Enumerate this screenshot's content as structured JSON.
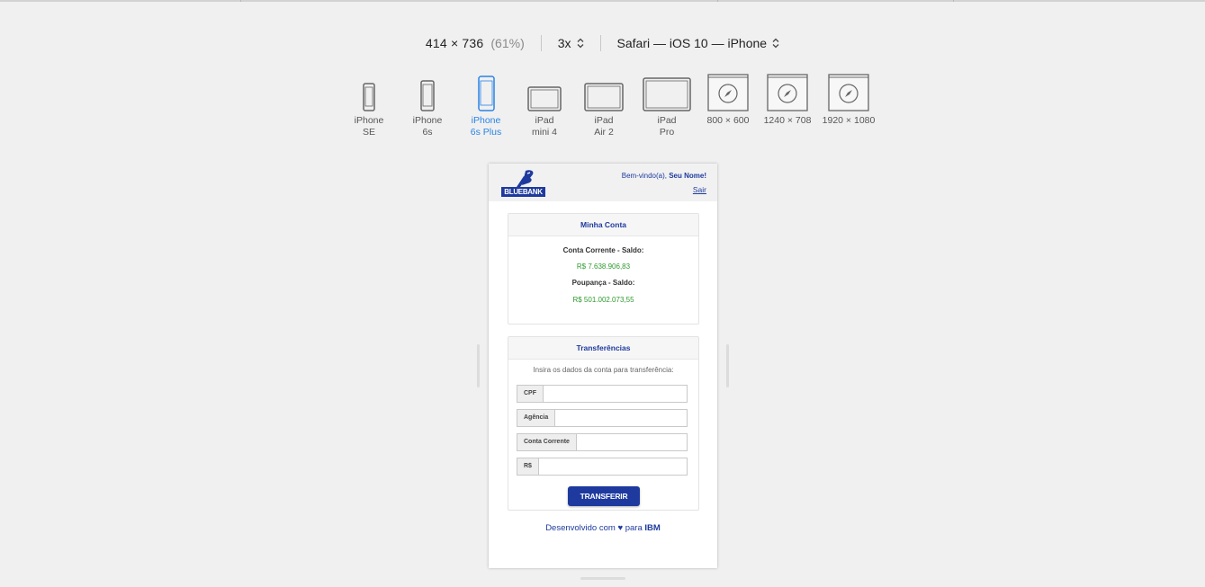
{
  "toolbar": {
    "dimensions": "414 × 736",
    "zoom": "(61%)",
    "scale": "3x",
    "user_agent": "Safari — iOS 10 — iPhone"
  },
  "devices": [
    {
      "label": "iPhone\nSE",
      "icon": "phone-icon",
      "active": false
    },
    {
      "label": "iPhone\n6s",
      "icon": "phone-icon",
      "active": false
    },
    {
      "label": "iPhone\n6s Plus",
      "icon": "phone-icon",
      "active": true
    },
    {
      "label": "iPad\nmini 4",
      "icon": "tablet-icon",
      "active": false
    },
    {
      "label": "iPad\nAir 2",
      "icon": "tablet-icon",
      "active": false
    },
    {
      "label": "iPad\nPro",
      "icon": "tablet-icon",
      "active": false
    },
    {
      "label": "800 × 600",
      "icon": "safari-compass-icon",
      "active": false
    },
    {
      "label": "1240 × 708",
      "icon": "safari-compass-icon",
      "active": false
    },
    {
      "label": "1920 × 1080",
      "icon": "safari-compass-icon",
      "active": false
    }
  ],
  "app": {
    "logo_text": "BLUEBANK",
    "welcome_prefix": "Bem-vindo(a), ",
    "user_name": "Seu Nome!",
    "logout": "Sair",
    "account_card": {
      "title": "Minha Conta",
      "checking_label": "Conta Corrente - Saldo:",
      "checking_value": "R$ 7.638.906,83",
      "savings_label": "Poupança - Saldo:",
      "savings_value": "R$ 501.002.073,55"
    },
    "transfer_card": {
      "title": "Transferências",
      "hint": "Insira os dados da conta para transferência:",
      "fields": [
        {
          "addon": "CPF",
          "value": ""
        },
        {
          "addon": "Agência",
          "value": ""
        },
        {
          "addon": "Conta Corrente",
          "value": ""
        },
        {
          "addon": "R$",
          "value": ""
        }
      ],
      "submit": "TRANSFERIR"
    },
    "footer_prefix": "Desenvolvido com ",
    "footer_heart": "♥",
    "footer_mid": " para ",
    "footer_brand": "IBM"
  },
  "colors": {
    "brand_blue": "#1e3a9e",
    "active_device": "#2a83e6",
    "balance_green": "#2e9a2e"
  }
}
